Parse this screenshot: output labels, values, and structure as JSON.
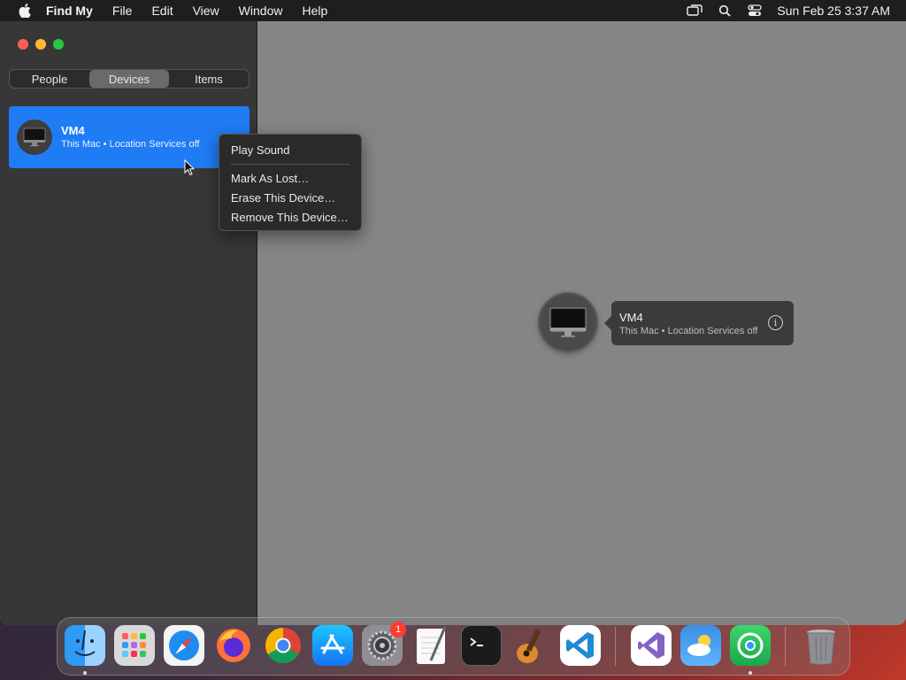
{
  "menubar": {
    "app_name": "Find My",
    "menus": [
      "File",
      "Edit",
      "View",
      "Window",
      "Help"
    ],
    "clock": "Sun Feb 25  3:37 AM"
  },
  "sidebar": {
    "tabs": [
      "People",
      "Devices",
      "Items"
    ],
    "selected_tab": "Devices",
    "device": {
      "name": "VM4",
      "subtitle": "This Mac • Location Services off"
    }
  },
  "context_menu": {
    "items": [
      "Play Sound",
      "Mark As Lost…",
      "Erase This Device…",
      "Remove This Device…"
    ]
  },
  "map_callout": {
    "name": "VM4",
    "subtitle": "This Mac • Location Services off",
    "info_glyph": "i"
  },
  "dock": {
    "badge_count": "1",
    "apps": [
      "finder-icon",
      "launchpad-icon",
      "safari-icon",
      "firefox-icon",
      "chrome-icon",
      "app-store-icon",
      "system-settings-icon",
      "textedit-icon",
      "terminal-icon",
      "garageband-icon",
      "vscode-icon",
      "visual-studio-icon",
      "weather-icon",
      "find-my-icon",
      "trash-icon"
    ]
  },
  "colors": {
    "accent": "#1f7cf4",
    "map_bg": "#858585",
    "sidebar_bg": "#373737"
  }
}
